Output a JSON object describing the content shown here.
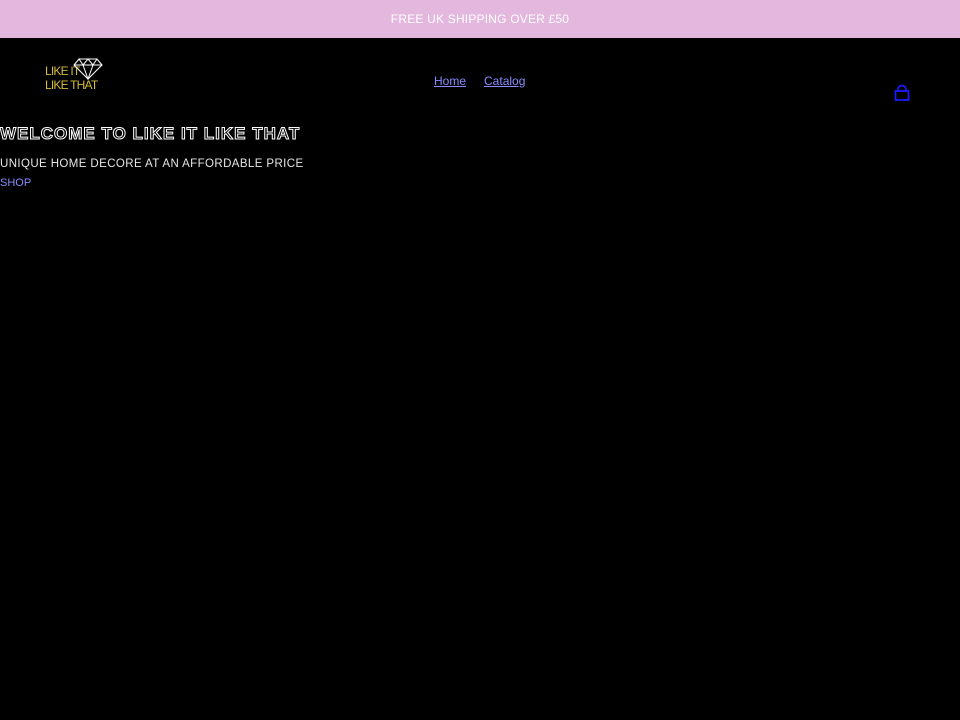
{
  "announcement": {
    "text": "FREE UK SHIPPING OVER £50"
  },
  "header": {
    "logo": {
      "line1": "LIKE IT",
      "line2": "LIKE THAT",
      "icon": "diamond-icon"
    },
    "nav": [
      {
        "label": "Home"
      },
      {
        "label": "Catalog"
      }
    ],
    "cart_icon": "bag-icon"
  },
  "hero": {
    "title": "WELCOME TO LIKE IT LIKE THAT",
    "subtitle": "UNIQUE HOME DECORE AT AN AFFORDABLE PRICE",
    "link": "SHOP"
  },
  "colors": {
    "announcement_bg": "#e4b7de",
    "page_bg": "#000000",
    "logo": "#d4bc3a",
    "link": "#8a8cff",
    "cart": "#1a1aff"
  }
}
